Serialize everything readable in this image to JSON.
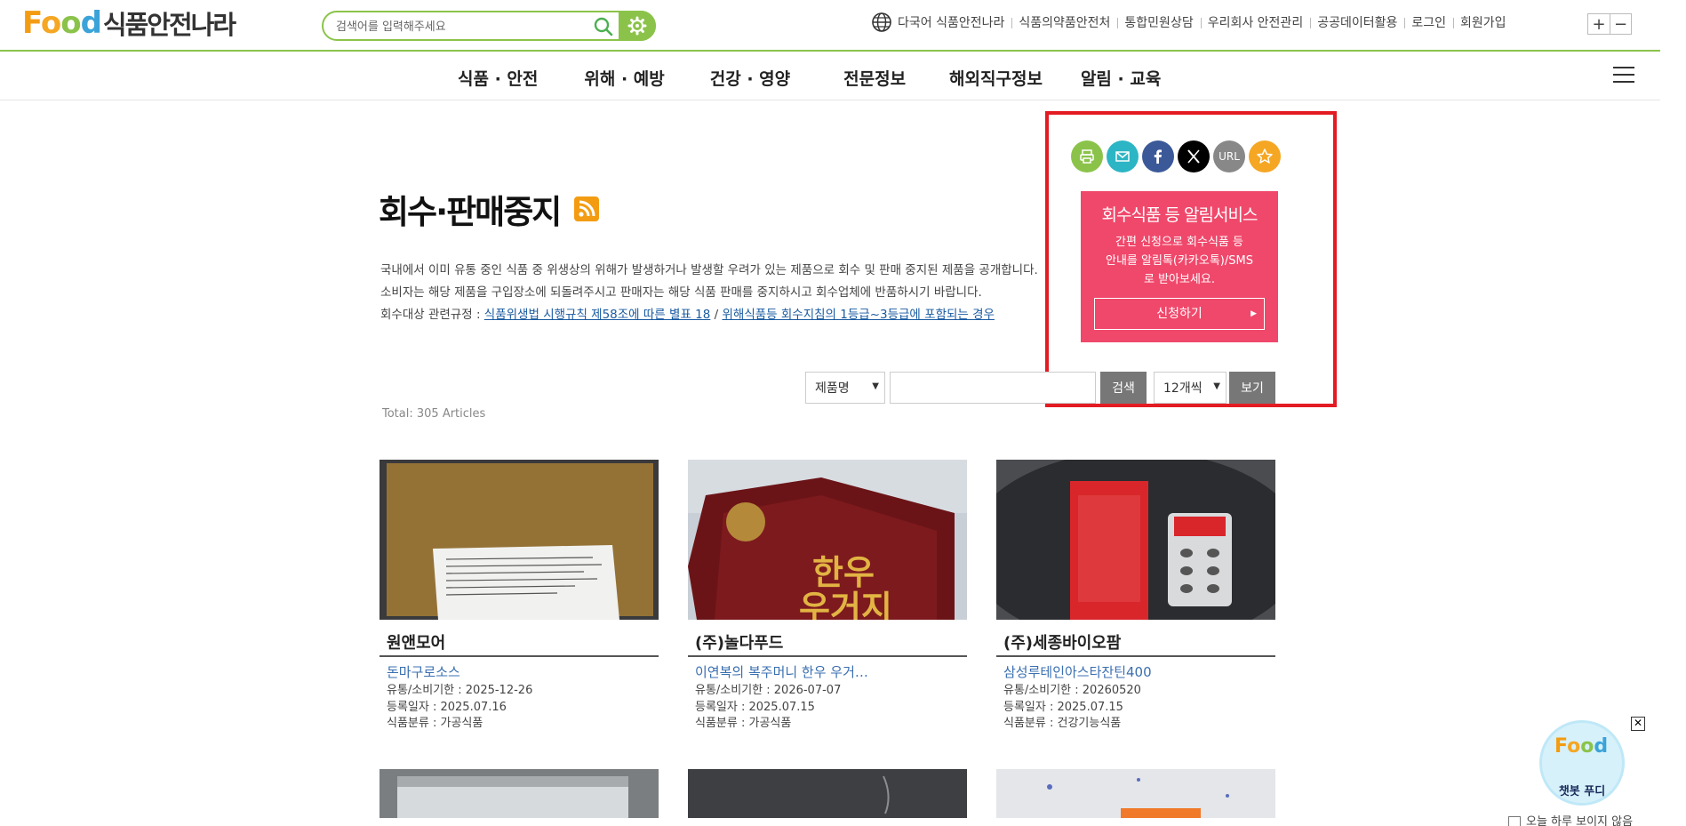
{
  "header": {
    "logo_text": "식품안전나라",
    "search_placeholder": "검색어를 입력해주세요",
    "util_links": [
      "다국어 식품안전나라",
      "식품의약품안전처",
      "통합민원상담",
      "우리회사 안전관리",
      "공공데이터활용",
      "로그인",
      "회원가입"
    ],
    "zoom_in": "+",
    "zoom_out": "−"
  },
  "mainnav": {
    "items": [
      "식품 · 안전",
      "위해 · 예방",
      "건강 · 영양",
      "전문정보",
      "해외직구정보",
      "알림 · 교육"
    ]
  },
  "page": {
    "title": "회수·판매중지",
    "desc_line1": "국내에서 이미 유통 중인 식품 중 위생상의 위해가 발생하거나 발생할 우려가 있는 제품으로 회수 및 판매 중지된 제품을 공개합니다.",
    "desc_line2": "소비자는 해당 제품을 구입장소에 되돌려주시고 판매자는 해당 식품 판매를 중지하시고 회수업체에 반품하시기 바랍니다.",
    "desc_line3_prefix": "회수대상 관련규정 :",
    "desc_link1": "식품위생법 시행규칙 제58조에 따른 별표 18",
    "desc_sep": " / ",
    "desc_link2": "위해식품등 회수지침의 1등급~3등급에 포함되는 경우"
  },
  "share": {
    "url_label": "URL"
  },
  "alert_service": {
    "title": "회수식품 등 알림서비스",
    "desc1": "간편 신청으로 회수식품 등",
    "desc2": "안내를 알림톡(카카오톡)/SMS",
    "desc3": "로 받아보세요.",
    "button": "신청하기"
  },
  "search": {
    "field_select": "제품명",
    "search_button": "검색",
    "count_select": "12개씩",
    "view_button": "보기"
  },
  "total": "Total: 305 Articles",
  "cards": [
    {
      "company": "원앤모어",
      "product": "돈마구로소스",
      "expiry": "유통/소비기한 : 2025-12-26",
      "registered": "등록일자 : 2025.07.16",
      "category": "식품분류 : 가공식품"
    },
    {
      "company": "(주)놀다푸드",
      "product": "이연복의 복주머니 한우 우거…",
      "expiry": "유통/소비기한 : 2026-07-07",
      "registered": "등록일자 : 2025.07.15",
      "category": "식품분류 : 가공식품"
    },
    {
      "company": "(주)세종바이오팜",
      "product": "삼성루테인아스타잔틴400",
      "expiry": "유통/소비기한 : 20260520",
      "registered": "등록일자 : 2025.07.15",
      "category": "식품분류 : 건강기능식품"
    }
  ],
  "chatbot": {
    "label": "챗봇 푸디",
    "close": "✕",
    "bottom_text": "오늘 하루 보이지 않음"
  }
}
